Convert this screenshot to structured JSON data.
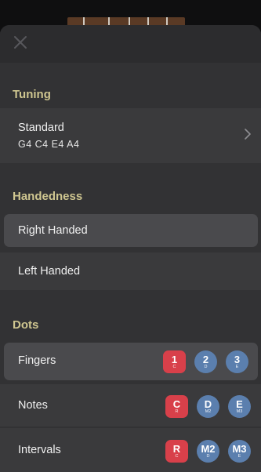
{
  "colors": {
    "section_title": "#cfc690",
    "finger_red": "#d8404a",
    "dot_blue": "#5b7fae"
  },
  "header": {
    "close_icon": "close-icon"
  },
  "tuning": {
    "title": "Tuning",
    "name": "Standard",
    "notes": "G4  C4  E4  A4"
  },
  "handedness": {
    "title": "Handedness",
    "options": [
      {
        "label": "Right Handed",
        "selected": true
      },
      {
        "label": "Left Handed",
        "selected": false
      }
    ]
  },
  "dots": {
    "title": "Dots",
    "rows": [
      {
        "label": "Fingers",
        "badges": [
          {
            "main": "1",
            "small": "C",
            "style": "red"
          },
          {
            "main": "2",
            "small": "D",
            "style": "blue"
          },
          {
            "main": "3",
            "small": "E",
            "style": "blue"
          }
        ]
      },
      {
        "label": "Notes",
        "badges": [
          {
            "main": "C",
            "small": "R",
            "style": "red"
          },
          {
            "main": "D",
            "small": "M2",
            "style": "blue"
          },
          {
            "main": "E",
            "small": "M3",
            "style": "blue"
          }
        ]
      },
      {
        "label": "Intervals",
        "badges": [
          {
            "main": "R",
            "small": "C",
            "style": "red"
          },
          {
            "main": "M2",
            "small": "D",
            "style": "blue"
          },
          {
            "main": "M3",
            "small": "E",
            "style": "blue"
          }
        ]
      }
    ]
  }
}
